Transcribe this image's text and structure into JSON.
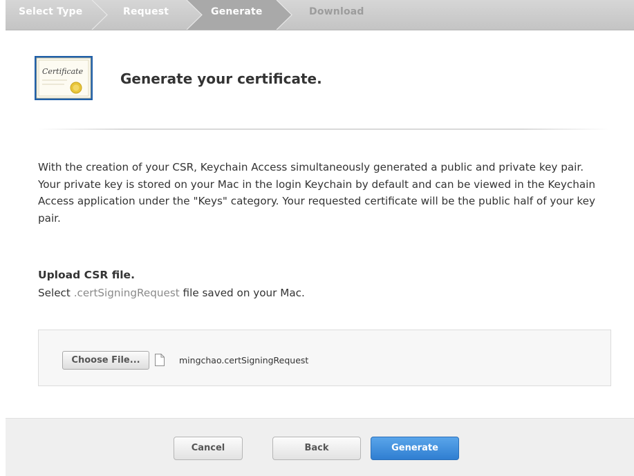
{
  "steps": [
    {
      "label": "Select Type",
      "state": "done"
    },
    {
      "label": "Request",
      "state": "done"
    },
    {
      "label": "Generate",
      "state": "current"
    },
    {
      "label": "Download",
      "state": "pending"
    }
  ],
  "header": {
    "icon_text": "Certificate",
    "title": "Generate your certificate."
  },
  "intro_text": "With the creation of your CSR, Keychain Access simultaneously generated a public and private key pair. Your private key is stored on your Mac in the login Keychain by default and can be viewed in the Keychain Access application under the \"Keys\" category. Your requested certificate will be the public half of your key pair.",
  "upload": {
    "title": "Upload CSR file.",
    "desc_prefix": "Select ",
    "desc_ext": ".certSigningRequest",
    "desc_suffix": " file saved on your Mac.",
    "choose_label": "Choose File...",
    "file_name": "mingchao.certSigningRequest"
  },
  "footer": {
    "cancel_label": "Cancel",
    "back_label": "Back",
    "generate_label": "Generate"
  },
  "colors": {
    "primary_button": "#2f7ed1",
    "step_bar": "#c9c9c9",
    "step_current": "#aaaaaa"
  }
}
